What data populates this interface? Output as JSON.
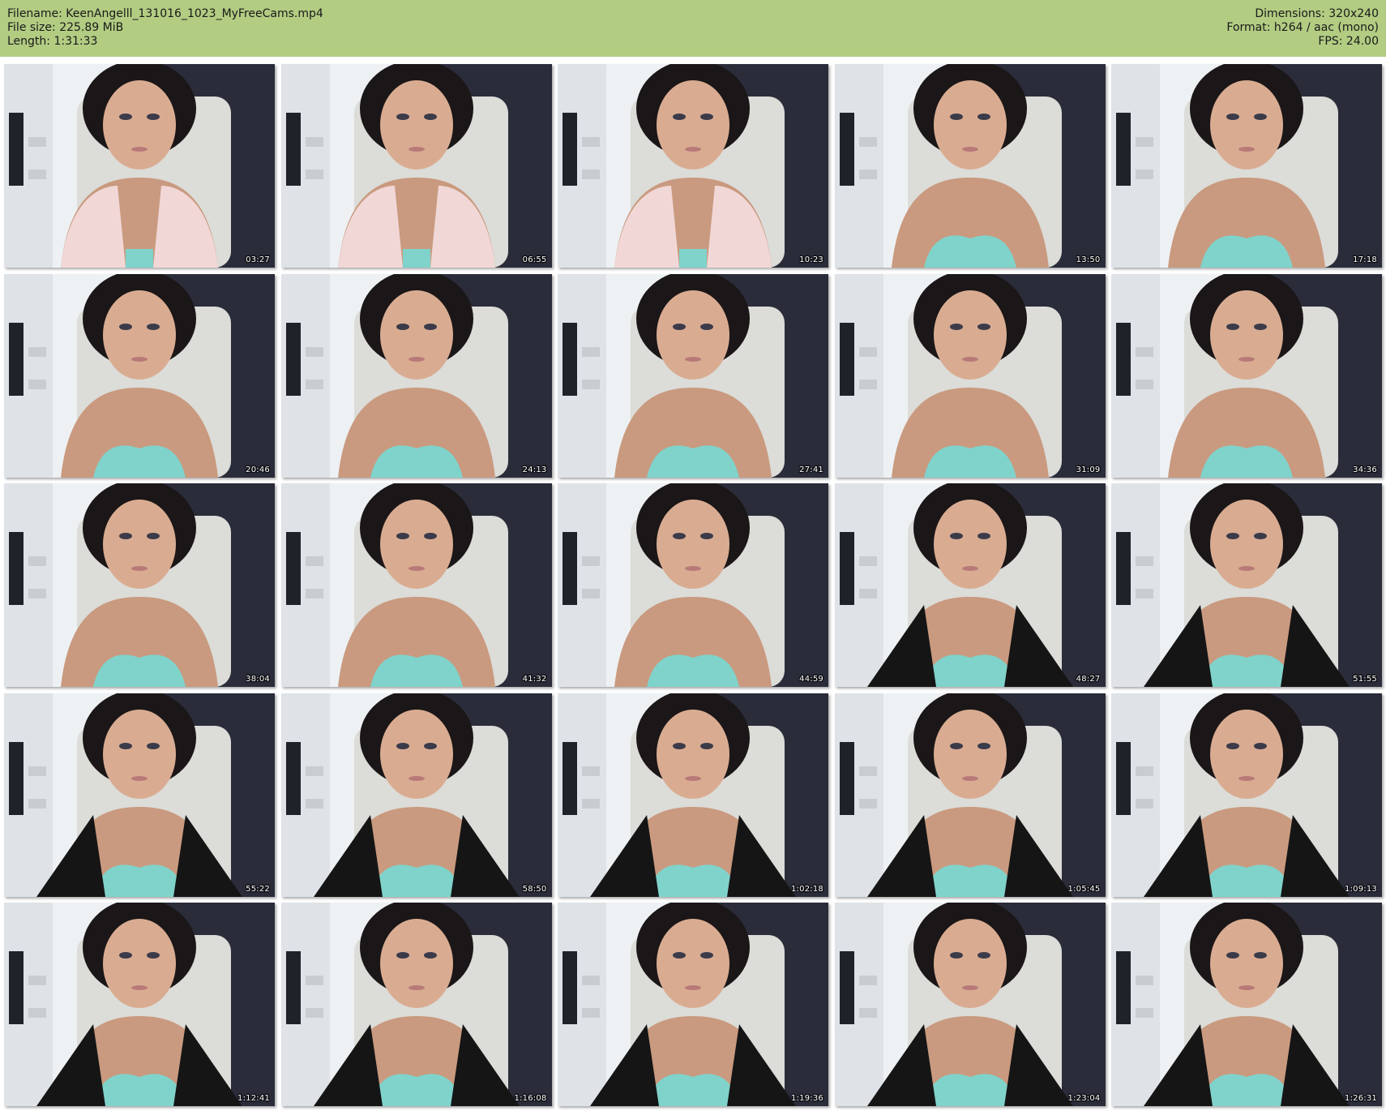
{
  "header": {
    "filename": "Filename: KeenAngelll_131016_1023_MyFreeCams.mp4",
    "filesize": "File size: 225.89 MiB",
    "length": "Length: 1:31:33",
    "dimensions": "Dimensions: 320x240",
    "format": "Format: h264 / aac (mono)",
    "fps": "FPS: 24.00"
  },
  "colors": {
    "header_bg": "#b2cc82",
    "page_bg": "#ffffff"
  },
  "thumbnails": [
    {
      "time": "03:27"
    },
    {
      "time": "06:55"
    },
    {
      "time": "10:23"
    },
    {
      "time": "13:50"
    },
    {
      "time": "17:18"
    },
    {
      "time": "20:46"
    },
    {
      "time": "24:13"
    },
    {
      "time": "27:41"
    },
    {
      "time": "31:09"
    },
    {
      "time": "34:36"
    },
    {
      "time": "38:04"
    },
    {
      "time": "41:32"
    },
    {
      "time": "44:59"
    },
    {
      "time": "48:27"
    },
    {
      "time": "51:55"
    },
    {
      "time": "55:22"
    },
    {
      "time": "58:50"
    },
    {
      "time": "1:02:18"
    },
    {
      "time": "1:05:45"
    },
    {
      "time": "1:09:13"
    },
    {
      "time": "1:12:41"
    },
    {
      "time": "1:16:08"
    },
    {
      "time": "1:19:36"
    },
    {
      "time": "1:23:04"
    },
    {
      "time": "1:26:31"
    }
  ]
}
